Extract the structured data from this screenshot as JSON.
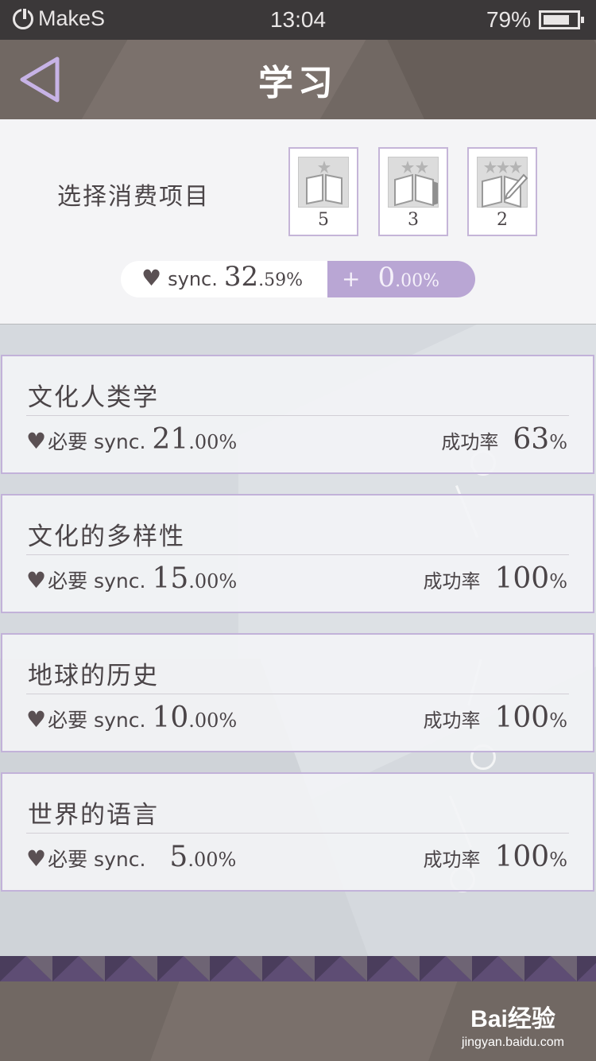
{
  "status_bar": {
    "carrier": "MakeS",
    "time": "13:04",
    "battery_percent": "79%",
    "battery_level": 0.79
  },
  "header": {
    "title": "学习",
    "back_icon": "triangle-left-icon"
  },
  "selection": {
    "label": "选择消费项目",
    "items": [
      {
        "stars": 1,
        "count": "5",
        "icon": "open-book-icon"
      },
      {
        "stars": 2,
        "count": "3",
        "icon": "open-book-icon"
      },
      {
        "stars": 3,
        "count": "2",
        "icon": "book-pen-icon"
      }
    ],
    "sync": {
      "label": "sync.",
      "value_int": "32",
      "value_dec": ".59%",
      "plus": "+",
      "bonus_int": "0",
      "bonus_dec": ".00%"
    }
  },
  "courses": [
    {
      "title": "文化人类学",
      "req_label": "必要 sync.",
      "req_int": "21",
      "req_dec": ".00%",
      "rate_label": "成功率",
      "rate_int": "63",
      "rate_dec": "%"
    },
    {
      "title": "文化的多样性",
      "req_label": "必要 sync.",
      "req_int": "15",
      "req_dec": ".00%",
      "rate_label": "成功率",
      "rate_int": "100",
      "rate_dec": "%"
    },
    {
      "title": "地球的历史",
      "req_label": "必要 sync.",
      "req_int": "10",
      "req_dec": ".00%",
      "rate_label": "成功率",
      "rate_int": "100",
      "rate_dec": "%"
    },
    {
      "title": "世界的语言",
      "req_label": "必要 sync.",
      "req_int": "5",
      "req_dec": ".00%",
      "rate_label": "成功率",
      "rate_int": "100",
      "rate_dec": "%"
    }
  ],
  "watermark": {
    "main": "Bai经验",
    "sub": "jingyan.baidu.com"
  },
  "colors": {
    "accent_purple": "#b9a6d4",
    "header_bg": "#716863",
    "text_dark": "#4b4548"
  }
}
